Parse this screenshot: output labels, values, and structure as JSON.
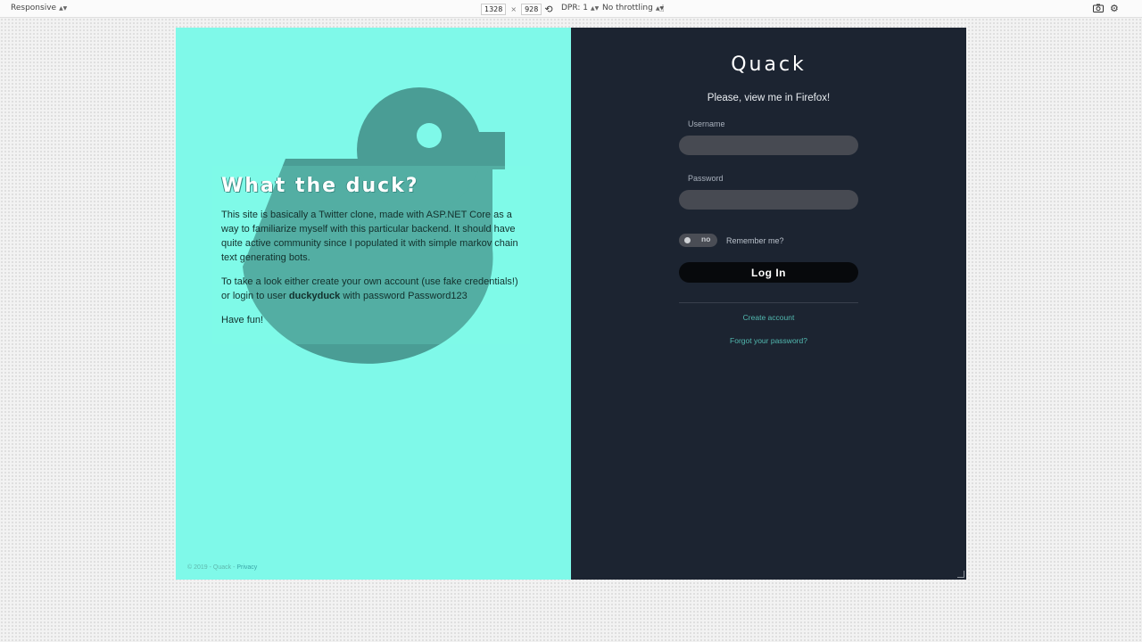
{
  "toolbar": {
    "device": "Responsive",
    "width": "1328",
    "height": "928",
    "times": "×",
    "dpr": "DPR: 1",
    "throttling": "No throttling"
  },
  "intro": {
    "title": "What the duck?",
    "para1": "This site is basically a Twitter clone, made with ASP.NET Core as a way to familiarize myself with this particular backend. It should have quite active community since I populated it with simple markov chain text generating bots.",
    "para2_prefix": "To take a look either create your own account (use fake credentials!) or login to user ",
    "para2_user": "duckyduck",
    "para2_suffix": " with password Password123",
    "para3": "Have fun!"
  },
  "footer": {
    "text": "© 2019 - Quack - ",
    "privacy": "Privacy"
  },
  "login": {
    "brand": "Quack",
    "notice": "Please, view me in Firefox!",
    "username_label": "Username",
    "username_value": "",
    "password_label": "Password",
    "password_value": "",
    "toggle_text": "no",
    "remember_label": "Remember me?",
    "login_button": "Log In",
    "create_account": "Create account",
    "forgot_password": "Forgot your password?"
  },
  "colors": {
    "left_bg": "#7ff9e9",
    "duck": "#4a9d95",
    "right_bg": "#1c2431",
    "accent_link": "#52b9b0"
  }
}
